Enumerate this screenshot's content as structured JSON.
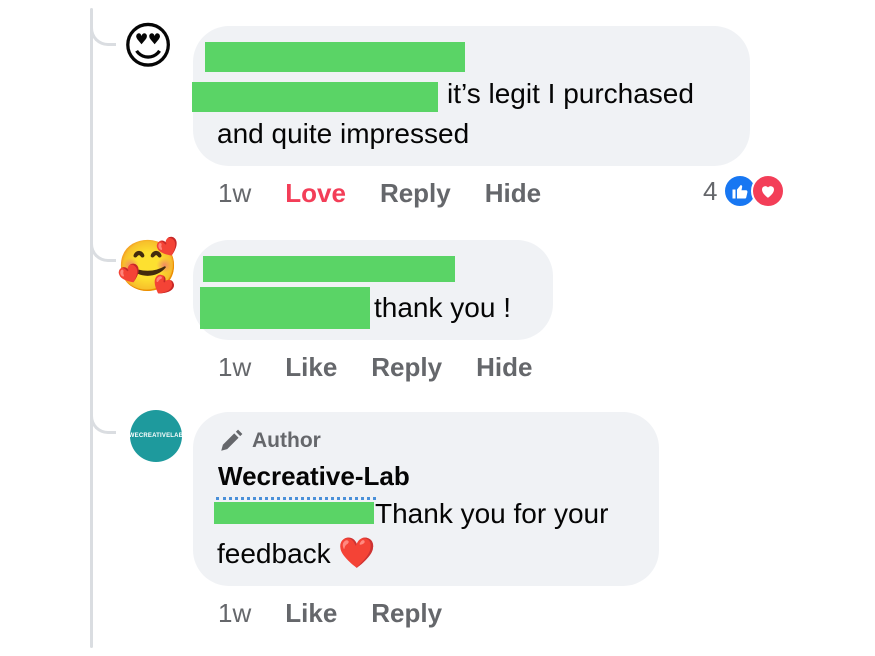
{
  "comments": [
    {
      "avatar_emoji": "😍",
      "text_after_redaction": "it’s legit I purchased",
      "text_line2": "and quite impressed",
      "time": "1w",
      "actions": [
        "Love",
        "Reply",
        "Hide"
      ],
      "reactions": {
        "count": "4",
        "types": [
          "like-icon",
          "love-icon"
        ]
      }
    },
    {
      "avatar_emoji": "🥰",
      "text_after_redaction": "thank you !",
      "time": "1w",
      "actions": [
        "Like",
        "Reply",
        "Hide"
      ]
    },
    {
      "avatar_logo_text": "WECREATIVELAB",
      "author_badge": "Author",
      "author_name": "Wecreative-Lab",
      "text_after_redaction": "Thank you for your",
      "text_line2": "feedback",
      "heart": "❤️",
      "time": "1w",
      "actions": [
        "Like",
        "Reply"
      ]
    }
  ],
  "colors": {
    "redaction": "#5ad466",
    "bubble": "#f0f2f5",
    "love": "#f33e58",
    "like": "#1877f2",
    "muted": "#65676b",
    "logo_bg": "#1e9a9d"
  }
}
